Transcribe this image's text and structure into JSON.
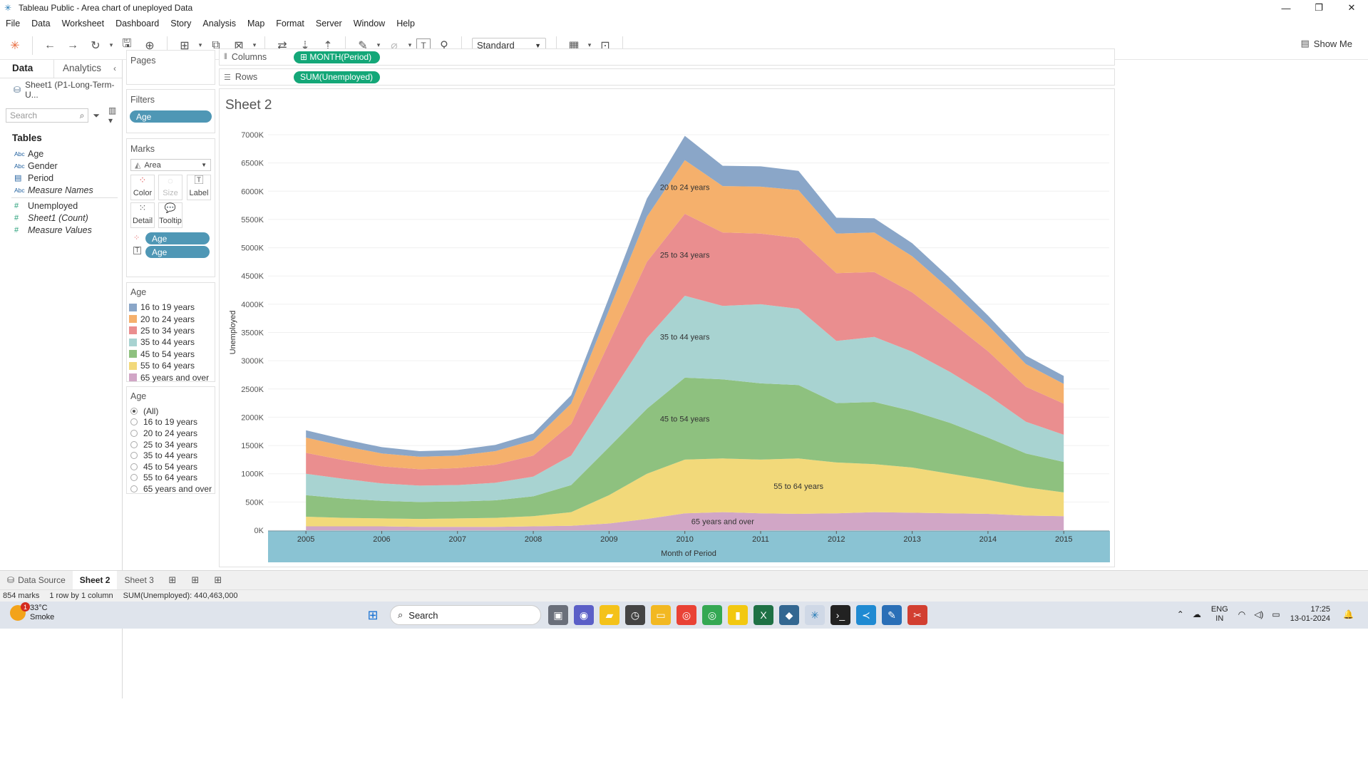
{
  "window": {
    "title": "Tableau Public - Area chart of uneployed Data",
    "buttons": [
      "—",
      "❐",
      "✕"
    ]
  },
  "menu": [
    "File",
    "Data",
    "Worksheet",
    "Dashboard",
    "Story",
    "Analysis",
    "Map",
    "Format",
    "Server",
    "Window",
    "Help"
  ],
  "toolbar": {
    "fit": "Standard",
    "show_me": "Show Me"
  },
  "data_pane": {
    "tabs": [
      "Data",
      "Analytics"
    ],
    "datasource": "Sheet1 (P1-Long-Term-U...",
    "search_placeholder": "Search",
    "tables_heading": "Tables",
    "dimensions": [
      {
        "type": "Abc",
        "name": "Age"
      },
      {
        "type": "Abc",
        "name": "Gender"
      },
      {
        "type": "▤",
        "name": "Period"
      },
      {
        "type": "Abc",
        "name": "Measure Names"
      }
    ],
    "measures": [
      {
        "type": "#",
        "name": "Unemployed"
      },
      {
        "type": "#",
        "name": "Sheet1 (Count)"
      },
      {
        "type": "#",
        "name": "Measure Values"
      }
    ]
  },
  "pages_card": {
    "title": "Pages"
  },
  "filters_card": {
    "title": "Filters",
    "pill": "Age"
  },
  "marks_card": {
    "title": "Marks",
    "mark_type": "Area",
    "buttons": [
      "Color",
      "Size",
      "Label",
      "Detail",
      "Tooltip"
    ],
    "pills": [
      "Age",
      "Age"
    ]
  },
  "legend": {
    "title": "Age",
    "items": [
      {
        "label": "16 to 19 years",
        "color": "#8aa6c8"
      },
      {
        "label": "20 to 24 years",
        "color": "#f5b06c"
      },
      {
        "label": "25 to 34 years",
        "color": "#ea8e8f"
      },
      {
        "label": "35 to 44 years",
        "color": "#a8d3d1"
      },
      {
        "label": "45 to 54 years",
        "color": "#8ec17f"
      },
      {
        "label": "55 to 64 years",
        "color": "#f2d97a"
      },
      {
        "label": "65 years and over",
        "color": "#d1a6c6"
      }
    ]
  },
  "filter_list": {
    "title": "Age",
    "options": [
      "(All)",
      "16 to 19 years",
      "20 to 24 years",
      "25 to 34 years",
      "35 to 44 years",
      "45 to 54 years",
      "55 to 64 years",
      "65 years and over"
    ],
    "selected": "(All)"
  },
  "shelves": {
    "columns_label": "Columns",
    "columns_pill": "⊞ MONTH(Period)",
    "rows_label": "Rows",
    "rows_pill": "SUM(Unemployed)"
  },
  "sheet": {
    "title": "Sheet 2"
  },
  "chart_data": {
    "type": "area",
    "stacked": true,
    "ylabel": "Unemployed",
    "xlabel": "Month of Period",
    "y_ticks": [
      "0K",
      "500K",
      "1000K",
      "1500K",
      "2000K",
      "2500K",
      "3000K",
      "3500K",
      "4000K",
      "4500K",
      "5000K",
      "5500K",
      "6000K",
      "6500K",
      "7000K"
    ],
    "ylim": [
      0,
      7000000
    ],
    "x_ticks": [
      "2005",
      "2006",
      "2007",
      "2008",
      "2009",
      "2010",
      "2011",
      "2012",
      "2013",
      "2014",
      "2015"
    ],
    "x": [
      2005.0,
      2005.5,
      2006.0,
      2006.5,
      2007.0,
      2007.5,
      2008.0,
      2008.5,
      2009.0,
      2009.5,
      2010.0,
      2010.5,
      2011.0,
      2011.5,
      2012.0,
      2012.5,
      2013.0,
      2013.5,
      2014.0,
      2014.5,
      2015.0
    ],
    "series": [
      {
        "name": "65 years and over",
        "color": "#d1a6c6",
        "values": [
          70000,
          70000,
          70000,
          60000,
          60000,
          60000,
          70000,
          80000,
          120000,
          200000,
          300000,
          320000,
          300000,
          290000,
          300000,
          320000,
          310000,
          300000,
          290000,
          260000,
          250000
        ]
      },
      {
        "name": "55 to 64 years",
        "color": "#f2d97a",
        "values": [
          170000,
          150000,
          140000,
          140000,
          150000,
          160000,
          180000,
          240000,
          500000,
          800000,
          950000,
          950000,
          950000,
          980000,
          900000,
          850000,
          800000,
          700000,
          600000,
          500000,
          420000
        ]
      },
      {
        "name": "45 to 54 years",
        "color": "#8ec17f",
        "values": [
          380000,
          340000,
          310000,
          300000,
          300000,
          310000,
          350000,
          480000,
          850000,
          1150000,
          1450000,
          1400000,
          1350000,
          1300000,
          1050000,
          1100000,
          1000000,
          900000,
          750000,
          600000,
          540000
        ]
      },
      {
        "name": "35 to 44 years",
        "color": "#a8d3d1",
        "values": [
          380000,
          350000,
          310000,
          290000,
          290000,
          310000,
          350000,
          520000,
          900000,
          1250000,
          1450000,
          1300000,
          1400000,
          1350000,
          1100000,
          1150000,
          1050000,
          900000,
          750000,
          560000,
          480000
        ]
      },
      {
        "name": "25 to 34 years",
        "color": "#ea8e8f",
        "values": [
          370000,
          330000,
          300000,
          290000,
          300000,
          320000,
          370000,
          560000,
          950000,
          1350000,
          1450000,
          1300000,
          1250000,
          1250000,
          1200000,
          1150000,
          1050000,
          900000,
          780000,
          620000,
          550000
        ]
      },
      {
        "name": "20 to 24 years",
        "color": "#f5b06c",
        "values": [
          270000,
          250000,
          230000,
          220000,
          220000,
          240000,
          270000,
          360000,
          580000,
          800000,
          950000,
          820000,
          830000,
          850000,
          700000,
          700000,
          640000,
          560000,
          460000,
          400000,
          350000
        ]
      },
      {
        "name": "16 to 19 years",
        "color": "#8aa6c8",
        "values": [
          130000,
          120000,
          110000,
          100000,
          100000,
          110000,
          120000,
          150000,
          220000,
          320000,
          430000,
          360000,
          360000,
          340000,
          280000,
          250000,
          230000,
          200000,
          170000,
          150000,
          140000
        ]
      }
    ],
    "area_labels": [
      {
        "series": "20 to 24 years",
        "text": "20 to 24 years"
      },
      {
        "series": "25 to 34 years",
        "text": "25 to 34 years"
      },
      {
        "series": "35 to 44 years",
        "text": "35 to 44 years"
      },
      {
        "series": "45 to 54 years",
        "text": "45 to 54 years"
      },
      {
        "series": "55 to 64 years",
        "text": "55 to 64 years"
      },
      {
        "series": "65 years and over",
        "text": "65 years and over"
      }
    ]
  },
  "bottom_tabs": [
    "Data Source",
    "Sheet 2",
    "Sheet 3"
  ],
  "status": {
    "marks": "854 marks",
    "dims": "1 row by 1 column",
    "sum": "SUM(Unemployed): 440,463,000"
  },
  "taskbar": {
    "weather_temp": "33°C",
    "weather_desc": "Smoke",
    "weather_badge": "1",
    "search": "Search",
    "lang": "ENG",
    "region": "IN",
    "time": "17:25",
    "date": "13-01-2024"
  }
}
